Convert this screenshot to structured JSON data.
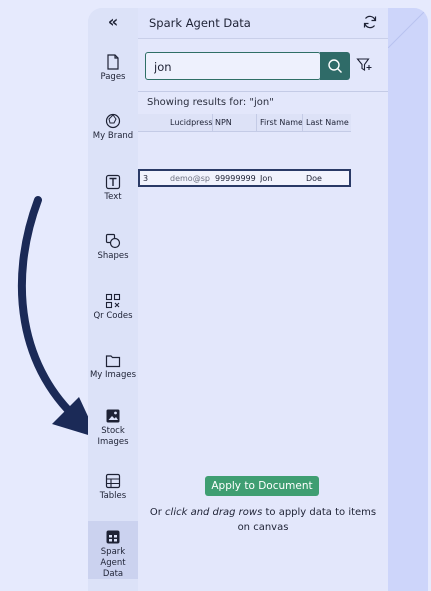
{
  "header": {
    "title": "Spark Agent Data"
  },
  "sidebar": {
    "collapse_glyph": "«",
    "items": [
      {
        "label": "Pages",
        "icon": "pages-icon"
      },
      {
        "label": "My Brand",
        "icon": "palette-icon"
      },
      {
        "label": "Text",
        "icon": "text-icon"
      },
      {
        "label": "Shapes",
        "icon": "shapes-icon"
      },
      {
        "label": "Qr Codes",
        "icon": "qr-code-icon"
      },
      {
        "label": "My Images",
        "icon": "folder-icon"
      },
      {
        "label": "Stock\nImages",
        "icon": "image-icon"
      },
      {
        "label": "Tables",
        "icon": "table-icon"
      },
      {
        "label": "Spark Agent\nData",
        "icon": "data-icon",
        "active": true
      }
    ]
  },
  "search": {
    "value": "jon",
    "placeholder": ""
  },
  "results": {
    "label": "Showing results for: \"jon\"",
    "columns": [
      "",
      "Lucidpress",
      "NPN",
      "First Name",
      "Last Name"
    ],
    "rows": [
      {
        "index": "3",
        "lucidpress": "demo@sp",
        "npn": "99999999",
        "first": "Jon",
        "last": "Doe"
      }
    ]
  },
  "apply_button": "Apply to Document",
  "hint": {
    "prefix": "Or ",
    "italic": "click and drag rows",
    "suffix": " to apply data to items on canvas"
  },
  "colors": {
    "background": "#e6eafd",
    "accent_green": "#3f9e72",
    "search_teal": "#2f6b68",
    "arrow_navy": "#1b2a57"
  }
}
